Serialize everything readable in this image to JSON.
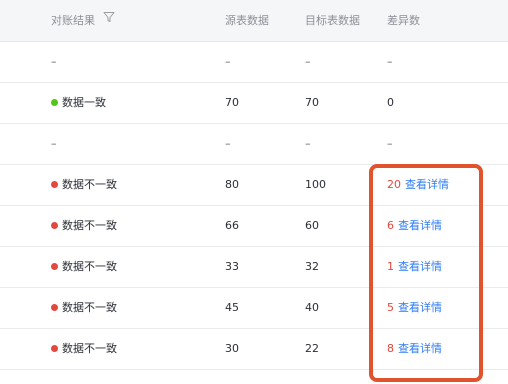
{
  "header": {
    "col_result": "对账结果",
    "col_source": "源表数据",
    "col_target": "目标表数据",
    "col_diff": "差异数",
    "filter_icon": "filter-icon"
  },
  "colors": {
    "consistent": "#52c41a",
    "inconsistent": "#e2483d",
    "link": "#2f7cf6",
    "highlight": "#e0532c"
  },
  "rows": [
    {
      "status": "",
      "result": "–",
      "source": "–",
      "target": "–",
      "diff": "–",
      "link": ""
    },
    {
      "status": "consistent",
      "result": "数据一致",
      "source": "70",
      "target": "70",
      "diff": "0",
      "link": ""
    },
    {
      "status": "",
      "result": "–",
      "source": "–",
      "target": "–",
      "diff": "–",
      "link": ""
    },
    {
      "status": "inconsistent",
      "result": "数据不一致",
      "source": "80",
      "target": "100",
      "diff": "20",
      "link": "查看详情"
    },
    {
      "status": "inconsistent",
      "result": "数据不一致",
      "source": "66",
      "target": "60",
      "diff": "6",
      "link": "查看详情"
    },
    {
      "status": "inconsistent",
      "result": "数据不一致",
      "source": "33",
      "target": "32",
      "diff": "1",
      "link": "查看详情"
    },
    {
      "status": "inconsistent",
      "result": "数据不一致",
      "source": "45",
      "target": "40",
      "diff": "5",
      "link": "查看详情"
    },
    {
      "status": "inconsistent",
      "result": "数据不一致",
      "source": "30",
      "target": "22",
      "diff": "8",
      "link": "查看详情"
    }
  ]
}
